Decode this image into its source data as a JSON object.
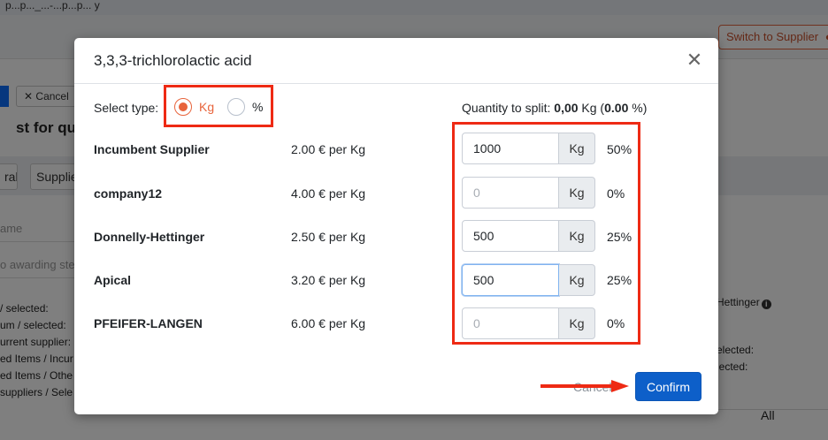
{
  "browser": {
    "url_fragment": "p...p..._...-...p...p... y"
  },
  "background": {
    "switch_button": "Switch to Supplier",
    "cancel_button": "Cancel",
    "heading": "st for quota",
    "tabs": [
      "ral",
      "Supplie"
    ],
    "name_field": "ame",
    "awarding_field": "o awarding ste",
    "stats": [
      "/ selected:",
      "um / selected:",
      "urrent supplier:",
      "ed Items / Incur",
      "ed Items / Othe",
      "suppliers / Sele"
    ],
    "right_title": "Hettinger",
    "right_stats": [
      "elected:",
      "lected:"
    ],
    "all_label": "All"
  },
  "modal": {
    "title": "3,3,3-trichlorolactic acid",
    "select_type_label": "Select type:",
    "type_options": [
      {
        "label": "Kg",
        "checked": true
      },
      {
        "label": "%",
        "checked": false
      }
    ],
    "quantity_to_split": {
      "prefix": "Quantity to split:",
      "value": "0,00",
      "unit": "Kg",
      "percent": "0.00",
      "percent_suffix": "%)"
    },
    "rows": [
      {
        "name": "Incumbent Supplier",
        "price": "2.00 € per Kg",
        "quantity": "1000",
        "placeholder": "",
        "unit": "Kg",
        "percent": "50%"
      },
      {
        "name": "company12",
        "price": "4.00 € per Kg",
        "quantity": "",
        "placeholder": "0",
        "unit": "Kg",
        "percent": "0%"
      },
      {
        "name": "Donnelly-Hettinger",
        "price": "2.50 € per Kg",
        "quantity": "500",
        "placeholder": "",
        "unit": "Kg",
        "percent": "25%"
      },
      {
        "name": "Apical",
        "price": "3.20 € per Kg",
        "quantity": "500",
        "placeholder": "",
        "unit": "Kg",
        "percent": "25%"
      },
      {
        "name": "PFEIFER-LANGEN",
        "price": "6.00 € per Kg",
        "quantity": "",
        "placeholder": "0",
        "unit": "Kg",
        "percent": "0%"
      }
    ],
    "cancel_label": "Cancel",
    "confirm_label": "Confirm"
  },
  "colors": {
    "accent_orange": "#e8643c",
    "primary_blue": "#0d5fc9",
    "annotation_red": "#ee2a14"
  }
}
